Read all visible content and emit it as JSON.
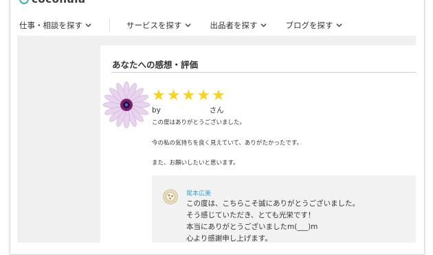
{
  "logo": {
    "text": "coconala"
  },
  "nav": {
    "items": [
      {
        "label": "仕事・相談を探す"
      },
      {
        "label": "サービスを探す"
      },
      {
        "label": "出品者を探す"
      },
      {
        "label": "ブログを探す"
      }
    ],
    "chevron": "chevron-down-icon"
  },
  "review": {
    "section_title": "あなたへの感想・評価",
    "rating": 5,
    "rating_max": 5,
    "star_glyph": "★",
    "by_prefix": "by",
    "by_suffix": "さん",
    "lines": [
      "この度はありがとうございました。",
      "今の私の気持ちを良く見えていて、ありがたかったです。",
      "また、お願いしたいと思います。"
    ]
  },
  "reply": {
    "author": "尾本広美",
    "lines": [
      "この度は、こちらこそ誠にありがとうございました。",
      "そう感じていただき、とても光栄です！",
      "本当にありがとうございましたm(___)m",
      "心より感謝申し上げます。"
    ]
  },
  "colors": {
    "accent": "#2fb3a8",
    "star": "#f8d21c",
    "author_link": "#3aa3d6",
    "band": "#f0f0f0"
  }
}
